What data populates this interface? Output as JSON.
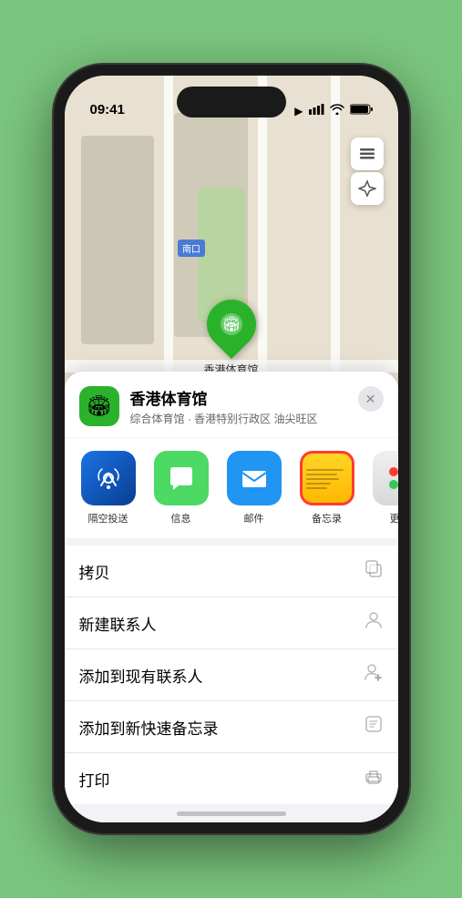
{
  "status": {
    "time": "09:41",
    "location_icon": "▶",
    "signal": "●●●",
    "wifi": "wifi",
    "battery": "battery"
  },
  "map": {
    "label_box_text": "南口",
    "venue_pin_label": "香港体育馆"
  },
  "map_controls": {
    "layers_icon": "🗺",
    "location_icon": "↗"
  },
  "sheet": {
    "close_icon": "✕",
    "venue_icon": "🏟",
    "venue_name": "香港体育馆",
    "venue_subtitle": "综合体育馆 · 香港特别行政区 油尖旺区"
  },
  "share_items": [
    {
      "id": "airdrop",
      "label": "隔空投送",
      "icon": "📡"
    },
    {
      "id": "messages",
      "label": "信息",
      "icon": "💬"
    },
    {
      "id": "mail",
      "label": "邮件",
      "icon": "✉"
    },
    {
      "id": "notes",
      "label": "备忘录",
      "icon": "notes"
    },
    {
      "id": "more",
      "label": "更多",
      "icon": "more"
    }
  ],
  "actions": [
    {
      "label": "拷贝",
      "icon": "copy"
    },
    {
      "label": "新建联系人",
      "icon": "person"
    },
    {
      "label": "添加到现有联系人",
      "icon": "person-add"
    },
    {
      "label": "添加到新快速备忘录",
      "icon": "note"
    },
    {
      "label": "打印",
      "icon": "print"
    }
  ]
}
